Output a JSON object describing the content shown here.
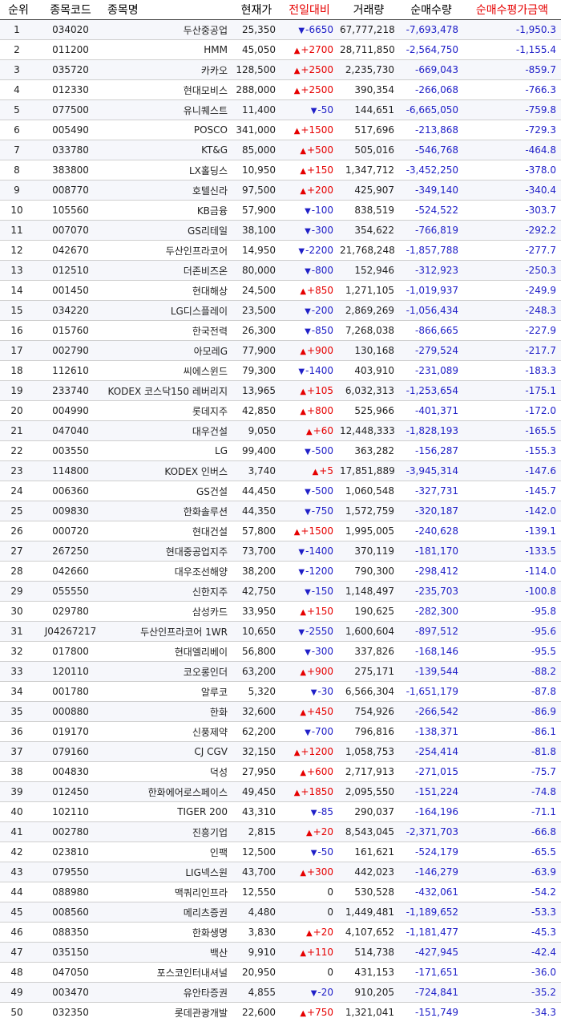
{
  "headers": [
    "순위",
    "종목코드",
    "종목명",
    "현재가",
    "전일대비",
    "거래량",
    "순매수량",
    "순매수평가금액"
  ],
  "colors": {
    "up": "#e60000",
    "down": "#2020c8",
    "header_accent": "#e60000"
  },
  "rows": [
    {
      "rank": "1",
      "code": "034020",
      "name": "두산중공업",
      "price": "25,350",
      "dir": "down",
      "change": "-6650",
      "volume": "67,777,218",
      "net_qty": "-7,693,478",
      "net_amt": "-1,950.3"
    },
    {
      "rank": "2",
      "code": "011200",
      "name": "HMM",
      "price": "45,050",
      "dir": "up",
      "change": "+2700",
      "volume": "28,711,850",
      "net_qty": "-2,564,750",
      "net_amt": "-1,155.4"
    },
    {
      "rank": "3",
      "code": "035720",
      "name": "카카오",
      "price": "128,500",
      "dir": "up",
      "change": "+2500",
      "volume": "2,235,730",
      "net_qty": "-669,043",
      "net_amt": "-859.7"
    },
    {
      "rank": "4",
      "code": "012330",
      "name": "현대모비스",
      "price": "288,000",
      "dir": "up",
      "change": "+2500",
      "volume": "390,354",
      "net_qty": "-266,068",
      "net_amt": "-766.3"
    },
    {
      "rank": "5",
      "code": "077500",
      "name": "유니퀘스트",
      "price": "11,400",
      "dir": "down",
      "change": "-50",
      "volume": "144,651",
      "net_qty": "-6,665,050",
      "net_amt": "-759.8"
    },
    {
      "rank": "6",
      "code": "005490",
      "name": "POSCO",
      "price": "341,000",
      "dir": "up",
      "change": "+1500",
      "volume": "517,696",
      "net_qty": "-213,868",
      "net_amt": "-729.3"
    },
    {
      "rank": "7",
      "code": "033780",
      "name": "KT&G",
      "price": "85,000",
      "dir": "up",
      "change": "+500",
      "volume": "505,016",
      "net_qty": "-546,768",
      "net_amt": "-464.8"
    },
    {
      "rank": "8",
      "code": "383800",
      "name": "LX홀딩스",
      "price": "10,950",
      "dir": "up",
      "change": "+150",
      "volume": "1,347,712",
      "net_qty": "-3,452,250",
      "net_amt": "-378.0"
    },
    {
      "rank": "9",
      "code": "008770",
      "name": "호텔신라",
      "price": "97,500",
      "dir": "up",
      "change": "+200",
      "volume": "425,907",
      "net_qty": "-349,140",
      "net_amt": "-340.4"
    },
    {
      "rank": "10",
      "code": "105560",
      "name": "KB금융",
      "price": "57,900",
      "dir": "down",
      "change": "-100",
      "volume": "838,519",
      "net_qty": "-524,522",
      "net_amt": "-303.7"
    },
    {
      "rank": "11",
      "code": "007070",
      "name": "GS리테일",
      "price": "38,100",
      "dir": "down",
      "change": "-300",
      "volume": "354,622",
      "net_qty": "-766,819",
      "net_amt": "-292.2"
    },
    {
      "rank": "12",
      "code": "042670",
      "name": "두산인프라코어",
      "price": "14,950",
      "dir": "down",
      "change": "-2200",
      "volume": "21,768,248",
      "net_qty": "-1,857,788",
      "net_amt": "-277.7"
    },
    {
      "rank": "13",
      "code": "012510",
      "name": "더존비즈온",
      "price": "80,000",
      "dir": "down",
      "change": "-800",
      "volume": "152,946",
      "net_qty": "-312,923",
      "net_amt": "-250.3"
    },
    {
      "rank": "14",
      "code": "001450",
      "name": "현대해상",
      "price": "24,500",
      "dir": "up",
      "change": "+850",
      "volume": "1,271,105",
      "net_qty": "-1,019,937",
      "net_amt": "-249.9"
    },
    {
      "rank": "15",
      "code": "034220",
      "name": "LG디스플레이",
      "price": "23,500",
      "dir": "down",
      "change": "-200",
      "volume": "2,869,269",
      "net_qty": "-1,056,434",
      "net_amt": "-248.3"
    },
    {
      "rank": "16",
      "code": "015760",
      "name": "한국전력",
      "price": "26,300",
      "dir": "down",
      "change": "-850",
      "volume": "7,268,038",
      "net_qty": "-866,665",
      "net_amt": "-227.9"
    },
    {
      "rank": "17",
      "code": "002790",
      "name": "아모레G",
      "price": "77,900",
      "dir": "up",
      "change": "+900",
      "volume": "130,168",
      "net_qty": "-279,524",
      "net_amt": "-217.7"
    },
    {
      "rank": "18",
      "code": "112610",
      "name": "씨에스윈드",
      "price": "79,300",
      "dir": "down",
      "change": "-1400",
      "volume": "403,910",
      "net_qty": "-231,089",
      "net_amt": "-183.3"
    },
    {
      "rank": "19",
      "code": "233740",
      "name": "KODEX 코스닥150 레버리지",
      "price": "13,965",
      "dir": "up",
      "change": "+105",
      "volume": "6,032,313",
      "net_qty": "-1,253,654",
      "net_amt": "-175.1"
    },
    {
      "rank": "20",
      "code": "004990",
      "name": "롯데지주",
      "price": "42,850",
      "dir": "up",
      "change": "+800",
      "volume": "525,966",
      "net_qty": "-401,371",
      "net_amt": "-172.0"
    },
    {
      "rank": "21",
      "code": "047040",
      "name": "대우건설",
      "price": "9,050",
      "dir": "up",
      "change": "+60",
      "volume": "12,448,333",
      "net_qty": "-1,828,193",
      "net_amt": "-165.5"
    },
    {
      "rank": "22",
      "code": "003550",
      "name": "LG",
      "price": "99,400",
      "dir": "down",
      "change": "-500",
      "volume": "363,282",
      "net_qty": "-156,287",
      "net_amt": "-155.3"
    },
    {
      "rank": "23",
      "code": "114800",
      "name": "KODEX 인버스",
      "price": "3,740",
      "dir": "up",
      "change": "+5",
      "volume": "17,851,889",
      "net_qty": "-3,945,314",
      "net_amt": "-147.6"
    },
    {
      "rank": "24",
      "code": "006360",
      "name": "GS건설",
      "price": "44,450",
      "dir": "down",
      "change": "-500",
      "volume": "1,060,548",
      "net_qty": "-327,731",
      "net_amt": "-145.7"
    },
    {
      "rank": "25",
      "code": "009830",
      "name": "한화솔루션",
      "price": "44,350",
      "dir": "down",
      "change": "-750",
      "volume": "1,572,759",
      "net_qty": "-320,187",
      "net_amt": "-142.0"
    },
    {
      "rank": "26",
      "code": "000720",
      "name": "현대건설",
      "price": "57,800",
      "dir": "up",
      "change": "+1500",
      "volume": "1,995,005",
      "net_qty": "-240,628",
      "net_amt": "-139.1"
    },
    {
      "rank": "27",
      "code": "267250",
      "name": "현대중공업지주",
      "price": "73,700",
      "dir": "down",
      "change": "-1400",
      "volume": "370,119",
      "net_qty": "-181,170",
      "net_amt": "-133.5"
    },
    {
      "rank": "28",
      "code": "042660",
      "name": "대우조선해양",
      "price": "38,200",
      "dir": "down",
      "change": "-1200",
      "volume": "790,300",
      "net_qty": "-298,412",
      "net_amt": "-114.0"
    },
    {
      "rank": "29",
      "code": "055550",
      "name": "신한지주",
      "price": "42,750",
      "dir": "down",
      "change": "-150",
      "volume": "1,148,497",
      "net_qty": "-235,703",
      "net_amt": "-100.8"
    },
    {
      "rank": "30",
      "code": "029780",
      "name": "삼성카드",
      "price": "33,950",
      "dir": "up",
      "change": "+150",
      "volume": "190,625",
      "net_qty": "-282,300",
      "net_amt": "-95.8"
    },
    {
      "rank": "31",
      "code": "J04267217",
      "name": "두산인프라코어 1WR",
      "price": "10,650",
      "dir": "down",
      "change": "-2550",
      "volume": "1,600,604",
      "net_qty": "-897,512",
      "net_amt": "-95.6"
    },
    {
      "rank": "32",
      "code": "017800",
      "name": "현대엘리베이",
      "price": "56,800",
      "dir": "down",
      "change": "-300",
      "volume": "337,826",
      "net_qty": "-168,146",
      "net_amt": "-95.5"
    },
    {
      "rank": "33",
      "code": "120110",
      "name": "코오롱인더",
      "price": "63,200",
      "dir": "up",
      "change": "+900",
      "volume": "275,171",
      "net_qty": "-139,544",
      "net_amt": "-88.2"
    },
    {
      "rank": "34",
      "code": "001780",
      "name": "알루코",
      "price": "5,320",
      "dir": "down",
      "change": "-30",
      "volume": "6,566,304",
      "net_qty": "-1,651,179",
      "net_amt": "-87.8"
    },
    {
      "rank": "35",
      "code": "000880",
      "name": "한화",
      "price": "32,600",
      "dir": "up",
      "change": "+450",
      "volume": "754,926",
      "net_qty": "-266,542",
      "net_amt": "-86.9"
    },
    {
      "rank": "36",
      "code": "019170",
      "name": "신풍제약",
      "price": "62,200",
      "dir": "down",
      "change": "-700",
      "volume": "796,816",
      "net_qty": "-138,371",
      "net_amt": "-86.1"
    },
    {
      "rank": "37",
      "code": "079160",
      "name": "CJ CGV",
      "price": "32,150",
      "dir": "up",
      "change": "+1200",
      "volume": "1,058,753",
      "net_qty": "-254,414",
      "net_amt": "-81.8"
    },
    {
      "rank": "38",
      "code": "004830",
      "name": "덕성",
      "price": "27,950",
      "dir": "up",
      "change": "+600",
      "volume": "2,717,913",
      "net_qty": "-271,015",
      "net_amt": "-75.7"
    },
    {
      "rank": "39",
      "code": "012450",
      "name": "한화에어로스페이스",
      "price": "49,450",
      "dir": "up",
      "change": "+1850",
      "volume": "2,095,550",
      "net_qty": "-151,224",
      "net_amt": "-74.8"
    },
    {
      "rank": "40",
      "code": "102110",
      "name": "TIGER 200",
      "price": "43,310",
      "dir": "down",
      "change": "-85",
      "volume": "290,037",
      "net_qty": "-164,196",
      "net_amt": "-71.1"
    },
    {
      "rank": "41",
      "code": "002780",
      "name": "진흥기업",
      "price": "2,815",
      "dir": "up",
      "change": "+20",
      "volume": "8,543,045",
      "net_qty": "-2,371,703",
      "net_amt": "-66.8"
    },
    {
      "rank": "42",
      "code": "023810",
      "name": "인팩",
      "price": "12,500",
      "dir": "down",
      "change": "-50",
      "volume": "161,621",
      "net_qty": "-524,179",
      "net_amt": "-65.5"
    },
    {
      "rank": "43",
      "code": "079550",
      "name": "LIG넥스원",
      "price": "43,700",
      "dir": "up",
      "change": "+300",
      "volume": "442,023",
      "net_qty": "-146,279",
      "net_amt": "-63.9"
    },
    {
      "rank": "44",
      "code": "088980",
      "name": "맥쿼리인프라",
      "price": "12,550",
      "dir": "flat",
      "change": "0",
      "volume": "530,528",
      "net_qty": "-432,061",
      "net_amt": "-54.2"
    },
    {
      "rank": "45",
      "code": "008560",
      "name": "메리츠증권",
      "price": "4,480",
      "dir": "flat",
      "change": "0",
      "volume": "1,449,481",
      "net_qty": "-1,189,652",
      "net_amt": "-53.3"
    },
    {
      "rank": "46",
      "code": "088350",
      "name": "한화생명",
      "price": "3,830",
      "dir": "up",
      "change": "+20",
      "volume": "4,107,652",
      "net_qty": "-1,181,477",
      "net_amt": "-45.3"
    },
    {
      "rank": "47",
      "code": "035150",
      "name": "백산",
      "price": "9,910",
      "dir": "up",
      "change": "+110",
      "volume": "514,738",
      "net_qty": "-427,945",
      "net_amt": "-42.4"
    },
    {
      "rank": "48",
      "code": "047050",
      "name": "포스코인터내셔널",
      "price": "20,950",
      "dir": "flat",
      "change": "0",
      "volume": "431,153",
      "net_qty": "-171,651",
      "net_amt": "-36.0"
    },
    {
      "rank": "49",
      "code": "003470",
      "name": "유안타증권",
      "price": "4,855",
      "dir": "down",
      "change": "-20",
      "volume": "910,205",
      "net_qty": "-724,841",
      "net_amt": "-35.2"
    },
    {
      "rank": "50",
      "code": "032350",
      "name": "롯데관광개발",
      "price": "22,600",
      "dir": "up",
      "change": "+750",
      "volume": "1,321,041",
      "net_qty": "-151,749",
      "net_amt": "-34.3"
    }
  ]
}
